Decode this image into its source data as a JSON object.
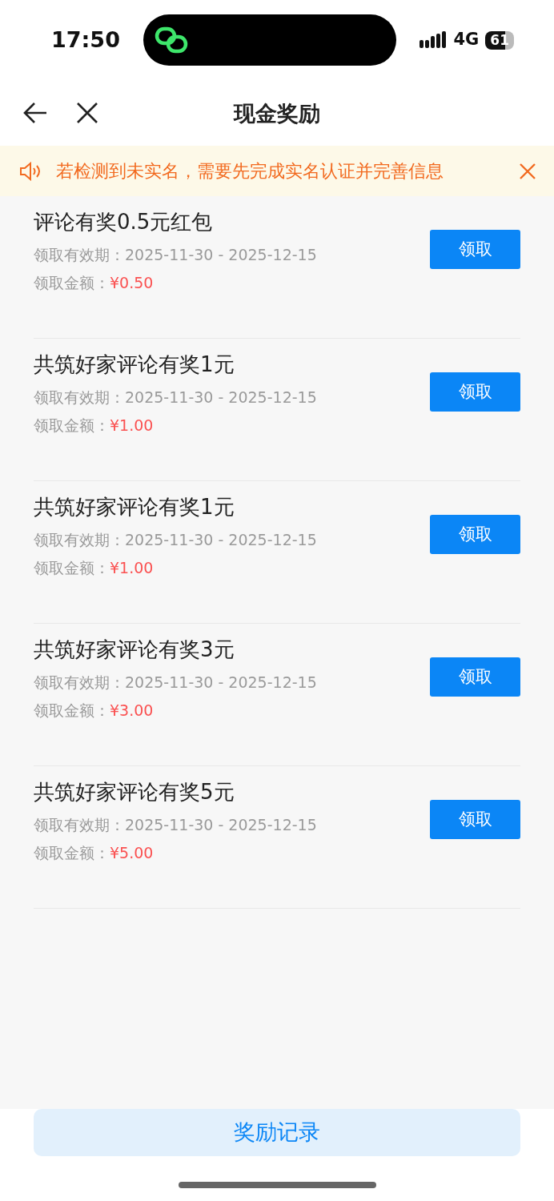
{
  "status_bar": {
    "time": "17:50",
    "network": "4G",
    "battery": "61"
  },
  "nav": {
    "title": "现金奖励"
  },
  "notice": {
    "text": "若检测到未实名，需要先完成实名认证并完善信息"
  },
  "rewards": [
    {
      "title": "评论有奖0.5元红包",
      "period_label": "领取有效期：",
      "period": "2025-11-30 - 2025-12-15",
      "amount_label": "领取金额：",
      "amount": "¥0.50",
      "button": "领取"
    },
    {
      "title": "共筑好家评论有奖1元",
      "period_label": "领取有效期：",
      "period": "2025-11-30 - 2025-12-15",
      "amount_label": "领取金额：",
      "amount": "¥1.00",
      "button": "领取"
    },
    {
      "title": "共筑好家评论有奖1元",
      "period_label": "领取有效期：",
      "period": "2025-11-30 - 2025-12-15",
      "amount_label": "领取金额：",
      "amount": "¥1.00",
      "button": "领取"
    },
    {
      "title": "共筑好家评论有奖3元",
      "period_label": "领取有效期：",
      "period": "2025-11-30 - 2025-12-15",
      "amount_label": "领取金额：",
      "amount": "¥3.00",
      "button": "领取"
    },
    {
      "title": "共筑好家评论有奖5元",
      "period_label": "领取有效期：",
      "period": "2025-11-30 - 2025-12-15",
      "amount_label": "领取金额：",
      "amount": "¥5.00",
      "button": "领取"
    }
  ],
  "footer": {
    "button": "奖励记录"
  }
}
